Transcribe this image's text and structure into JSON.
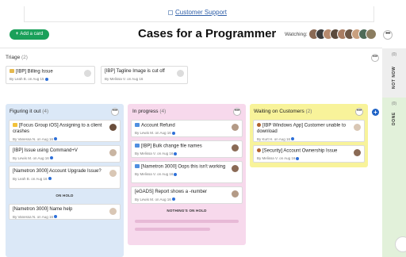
{
  "top_link": {
    "label": "Customer Support"
  },
  "toolbar": {
    "add_card_label": "Add a card",
    "add_card_plus": "+",
    "title": "Cases for a Programmer",
    "watching_label": "Watching:",
    "more": "•••"
  },
  "triage": {
    "title": "Triage",
    "count": "(2)",
    "more": "•••",
    "cards": [
      {
        "icon": "credit-card-icon",
        "title": "[IBP] Billing Issue",
        "meta": "By Leah B. on Aug 15"
      },
      {
        "icon": "none",
        "title": "[IBP] Tagline Image is cut off",
        "meta": "By Melissa V. on Aug 16"
      }
    ]
  },
  "side": {
    "not_now_count": "(0)",
    "not_now_label": "NOT NOW",
    "done_count": "(0)",
    "done_label": "DONE"
  },
  "columns": [
    {
      "title": "Figuring it out",
      "count": "(4)",
      "color": "#dbe8f7",
      "more": "•••",
      "cards": [
        {
          "icon": "warning-icon",
          "title": "[Focus Group iOS] Assigning to a client crashes",
          "meta": "By Vanessa N. on Aug 16"
        },
        {
          "title": "[IBP] Issue using Command+V",
          "meta": "By Lewis M. on Aug 16"
        },
        {
          "title": "[Nametron 3000] Account Upgrade Issue?",
          "meta": "By Leah B. on Aug 16"
        },
        {
          "title": "[Nametron 3000] Name help",
          "meta": "By Vanessa N. on Aug 16"
        }
      ],
      "divider": "ON HOLD"
    },
    {
      "title": "In progress",
      "count": "(4)",
      "color": "#f7d9ec",
      "more": "•••",
      "cards": [
        {
          "icon": "number-1-icon",
          "title": "Account Refund",
          "meta": "By Lewis M. on Aug 16"
        },
        {
          "icon": "number-2-icon",
          "title": "[IBP] Bulk change file names",
          "meta": "By Melissa V. on Aug 16"
        },
        {
          "icon": "number-3-icon",
          "title": "[Nametron 3000] Oops this isn't working",
          "meta": "By Melissa V. on Aug 16"
        },
        {
          "title": "[eGADS] Report shows a -number",
          "meta": "By Lewis M. on Aug 16"
        }
      ],
      "divider": "NOTHING'S ON HOLD"
    },
    {
      "title": "Waiting on Customers",
      "count": "(2)",
      "color": "#f8f39a",
      "more": "•••",
      "cards": [
        {
          "icon": "face-icon",
          "title": "[IBP Windows App] Customer unable to download",
          "meta": "By Kurt H. on Aug 16"
        },
        {
          "icon": "face-icon",
          "title": "[Security] Account Ownership Issue",
          "meta": "By Melissa V. on Aug 16"
        }
      ]
    }
  ],
  "add_column": "+",
  "colors": {
    "accent_green": "#1aa05a",
    "link_blue": "#2f5fa8",
    "plus_blue": "#1f63c6"
  }
}
